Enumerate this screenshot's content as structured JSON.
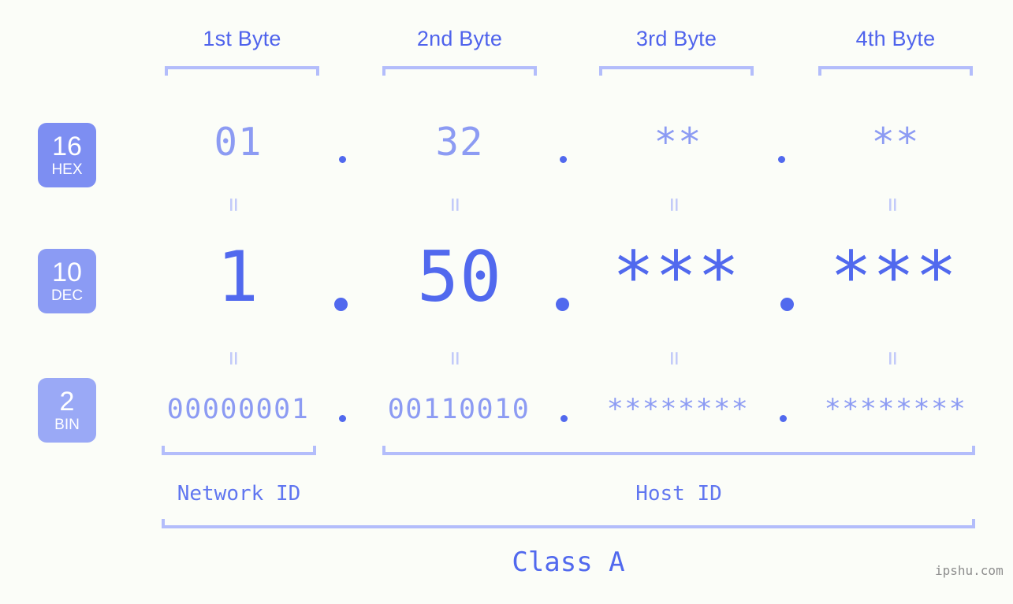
{
  "background_color": "#fbfdf8",
  "accent_color": "#5169ee",
  "muted_accent_color": "#8c9bf3",
  "bracket_color": "#b3bdfb",
  "byte_headers": [
    {
      "label": "1st Byte"
    },
    {
      "label": "2nd Byte"
    },
    {
      "label": "3rd Byte"
    },
    {
      "label": "4th Byte"
    }
  ],
  "rows": [
    {
      "base": "16",
      "abbr": "HEX",
      "badge_color": "#7d8ef2",
      "values": [
        "01",
        "32",
        "**",
        "**"
      ]
    },
    {
      "base": "10",
      "abbr": "DEC",
      "badge_color": "#8b9bf4",
      "values": [
        "1",
        "50",
        "***",
        "***"
      ]
    },
    {
      "base": "2",
      "abbr": "BIN",
      "badge_color": "#9aa9f6",
      "values": [
        "00000001",
        "00110010",
        "********",
        "********"
      ]
    }
  ],
  "separator": ".",
  "equality_mark": "=",
  "segments": {
    "network_id": "Network ID",
    "host_id": "Host ID"
  },
  "class_label": "Class A",
  "watermark": "ipshu.com"
}
